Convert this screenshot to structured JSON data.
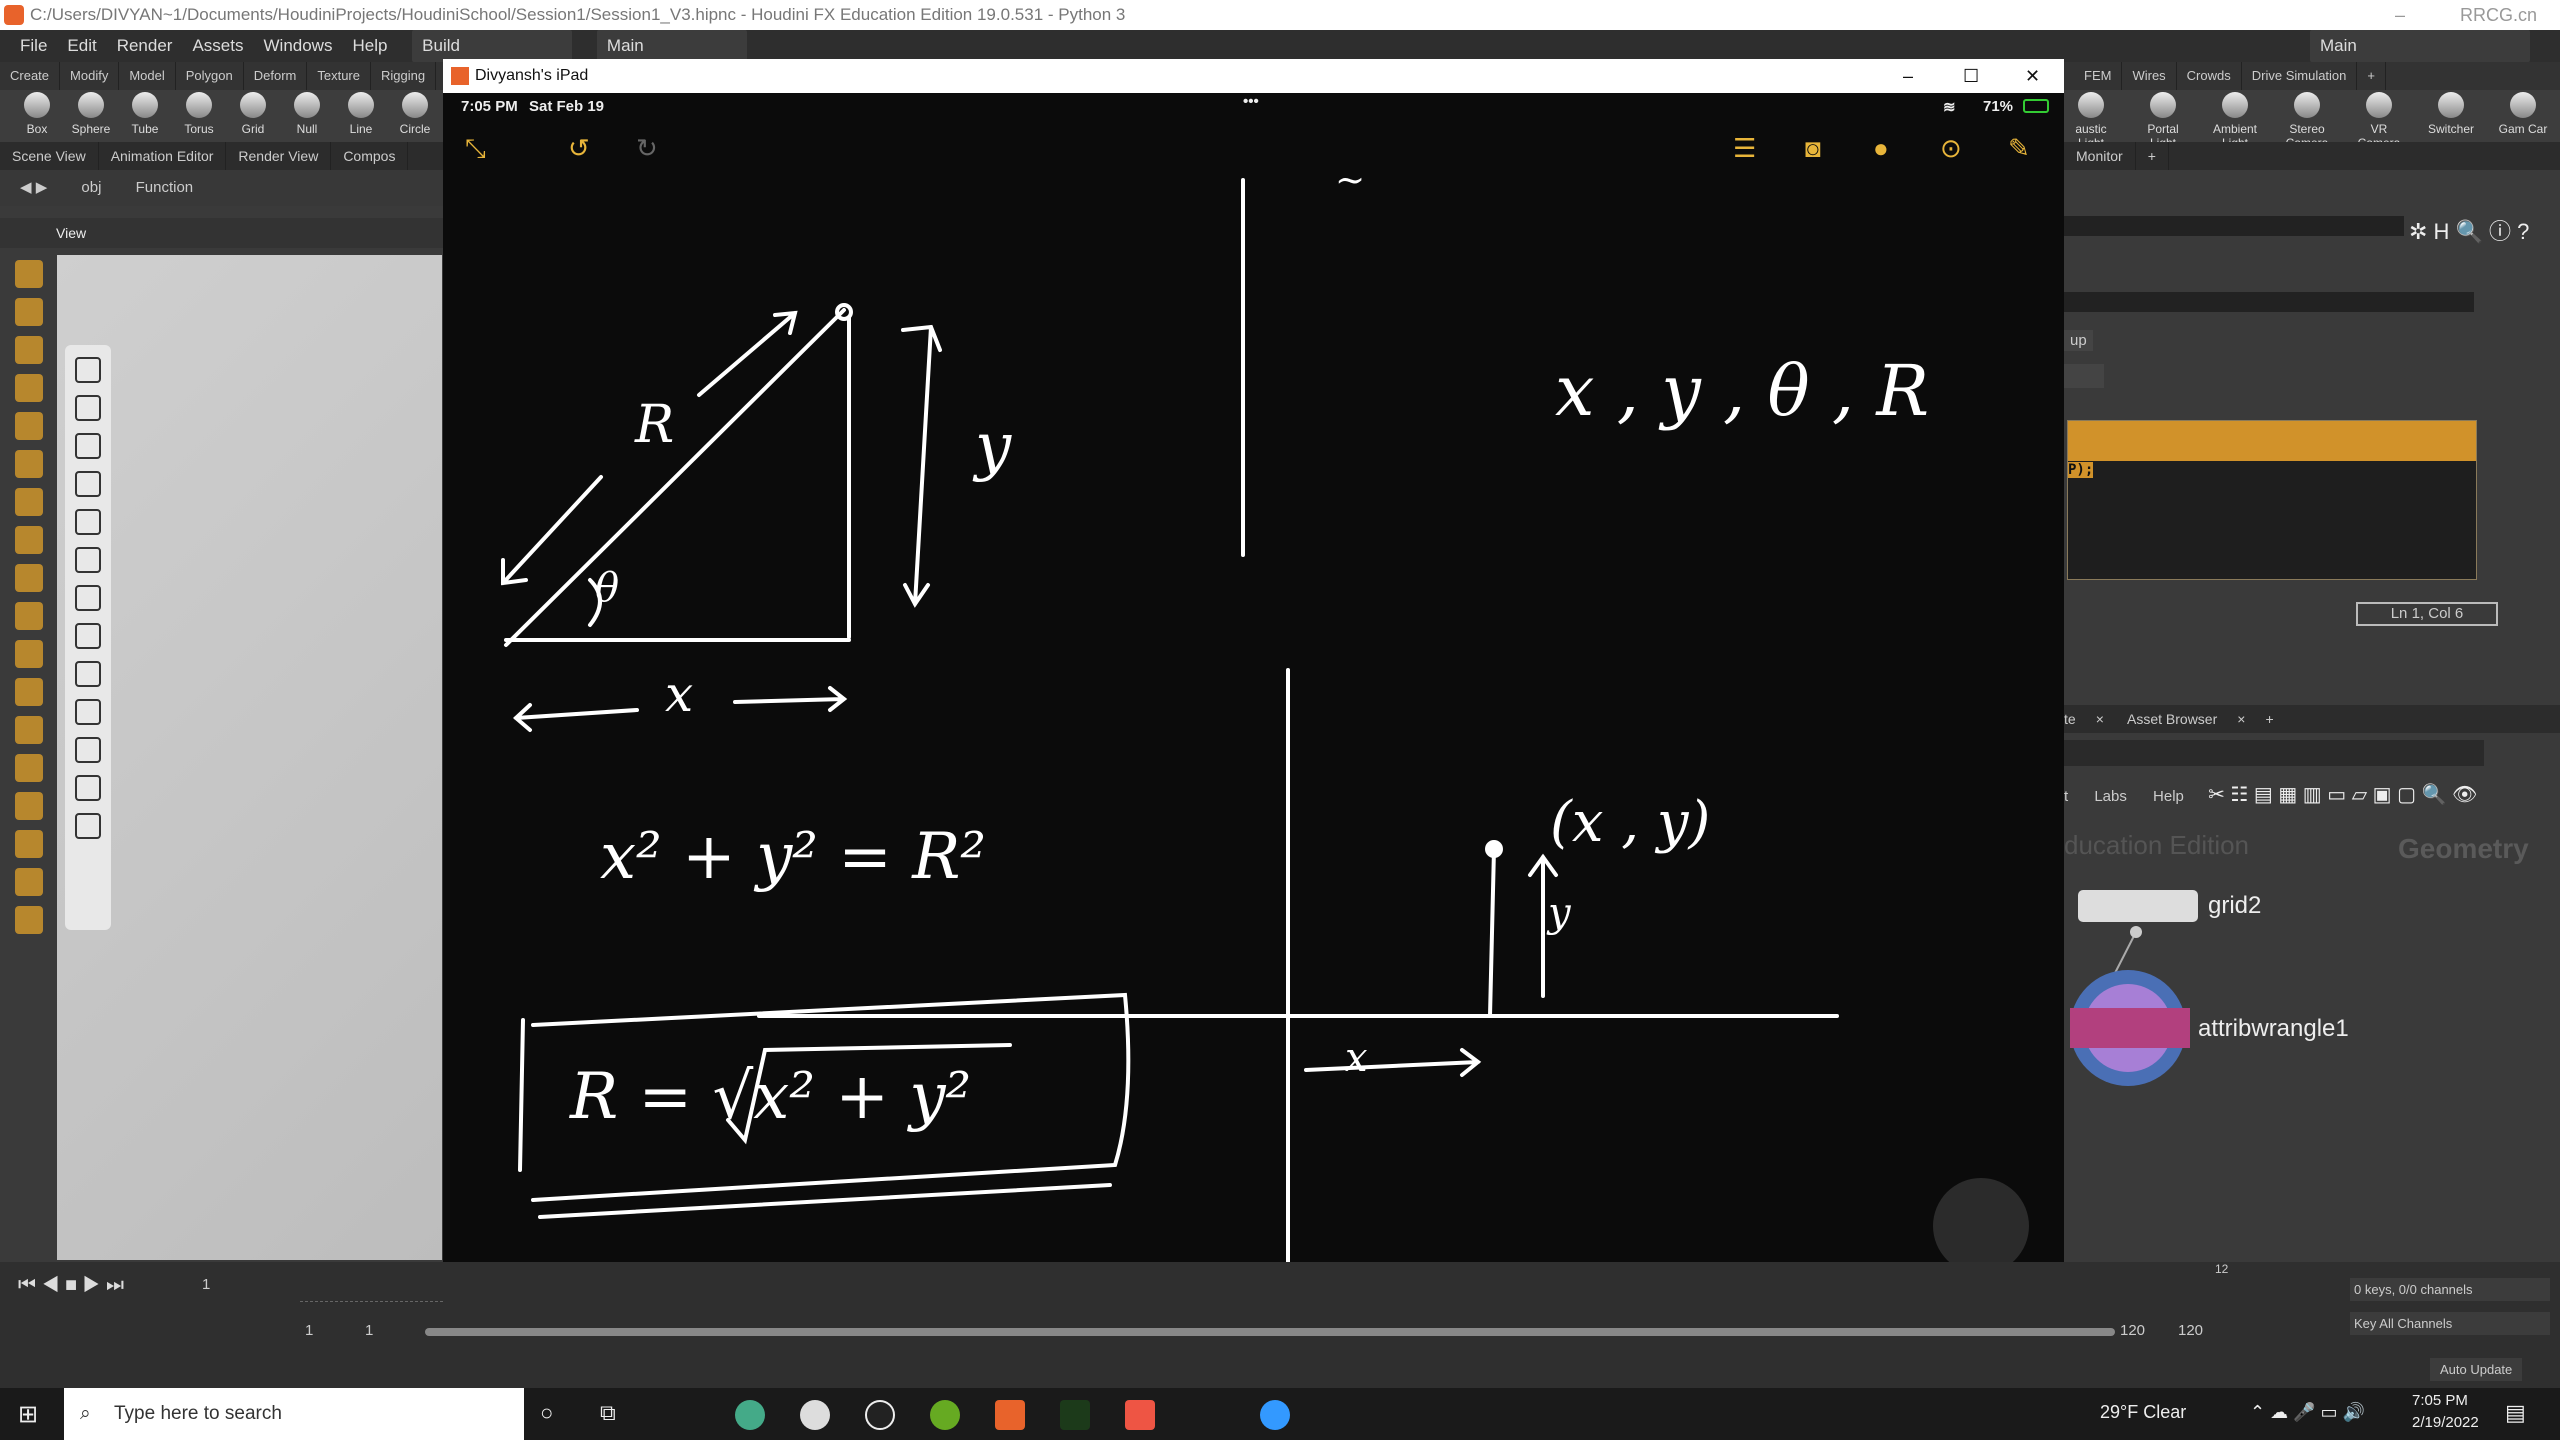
{
  "window": {
    "title": "C:/Users/DIVYAN~1/Documents/HoudiniProjects/HoudiniSchool/Session1/Session1_V3.hipnc - Houdini FX Education Edition 19.0.531 - Python 3",
    "watermark": "RRCG.cn"
  },
  "menu": {
    "items": [
      "File",
      "Edit",
      "Render",
      "Assets",
      "Windows",
      "Help"
    ],
    "desktop": "Build",
    "context": "Main",
    "right_desktop": "Main"
  },
  "shelf": {
    "tabs_left": [
      "Create",
      "Modify",
      "Model",
      "Polygon",
      "Deform",
      "Texture",
      "Rigging"
    ],
    "tabs_right": [
      "FEM",
      "Wires",
      "Crowds",
      "Drive Simulation"
    ],
    "tools_left": [
      "Box",
      "Sphere",
      "Tube",
      "Torus",
      "Grid",
      "Null",
      "Line",
      "Circle"
    ],
    "tools_right": [
      "austic Light",
      "Portal Light",
      "Ambient Light",
      "Stereo Camera",
      "VR Camera",
      "Switcher",
      "Gam Car"
    ]
  },
  "panes": {
    "tabs": [
      "Scene View",
      "Animation Editor",
      "Render View",
      "Compos"
    ],
    "path": [
      "obj",
      "Function"
    ],
    "view_label": "View",
    "monitor_tab": "Monitor"
  },
  "ipad": {
    "window_title": "Divyansh's iPad",
    "time": "7:05 PM",
    "date": "Sat Feb 19",
    "battery": "71%",
    "notes": {
      "r": "R",
      "y": "y",
      "theta": "θ",
      "x": "x",
      "vars": "x , y , θ , R",
      "eq1": "x² + y² = R²",
      "eq2": "R = √x² + y²",
      "point": "(x , y)",
      "y2": "y",
      "x2": "x",
      "mark": "~"
    }
  },
  "params": {
    "group": "up",
    "code_fragment": "P);",
    "cursor": "Ln 1, Col 6"
  },
  "network": {
    "tabs": [
      "te",
      "Asset Browser"
    ],
    "menu": [
      "t",
      "Labs",
      "Help"
    ],
    "edition": "ducation Edition",
    "context": "Geometry",
    "nodes": [
      "grid2",
      "attribwrangle1"
    ]
  },
  "playbar": {
    "frame": "1",
    "start": "1",
    "start2": "1",
    "end": "120",
    "end2": "120",
    "marker": "12",
    "keys": "0 keys, 0/0 channels",
    "key_all": "Key All Channels",
    "auto_update": "Auto Update"
  },
  "taskbar": {
    "search_placeholder": "Type here to search",
    "weather": "29°F  Clear",
    "time": "7:05 PM",
    "date": "2/19/2022"
  },
  "colors": {
    "accent": "#d1922a",
    "ipad_ink": "#ffffff",
    "ipad_tools": "#e8b53a"
  }
}
